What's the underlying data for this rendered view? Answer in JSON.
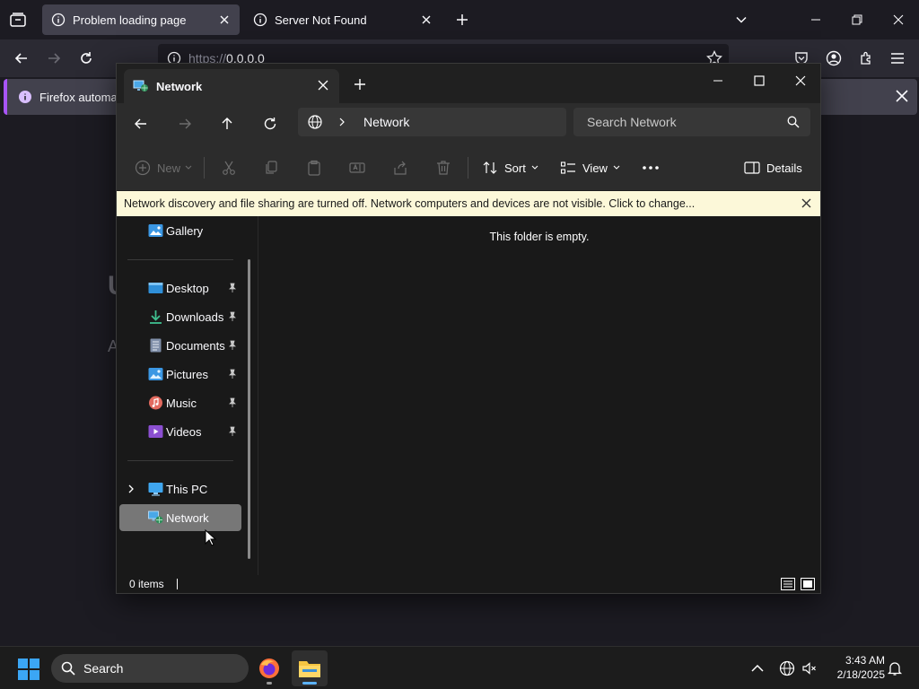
{
  "browser": {
    "tabs": [
      {
        "title": "Problem loading page",
        "active": true
      },
      {
        "title": "Server Not Found",
        "active": false
      }
    ],
    "url": {
      "scheme": "https://",
      "host": "0.0.0.0"
    },
    "notification": "Firefox automatic"
  },
  "explorer": {
    "tab_title": "Network",
    "breadcrumb": "Network",
    "search_placeholder": "Search Network",
    "commands": {
      "new": "New",
      "sort": "Sort",
      "view": "View",
      "details": "Details"
    },
    "infobar": "Network discovery and file sharing are turned off. Network computers and devices are not visible. Click to change...",
    "empty_message": "This folder is empty.",
    "nav": {
      "gallery": "Gallery",
      "quick_access": [
        {
          "label": "Desktop",
          "icon": "desktop-icon",
          "pinned": true
        },
        {
          "label": "Downloads",
          "icon": "downloads-icon",
          "pinned": true
        },
        {
          "label": "Documents",
          "icon": "documents-icon",
          "pinned": true
        },
        {
          "label": "Pictures",
          "icon": "pictures-icon",
          "pinned": true
        },
        {
          "label": "Music",
          "icon": "music-icon",
          "pinned": true
        },
        {
          "label": "Videos",
          "icon": "videos-icon",
          "pinned": true
        }
      ],
      "this_pc": "This PC",
      "network": "Network"
    },
    "status": {
      "item_count": "0 items"
    }
  },
  "taskbar": {
    "search_label": "Search",
    "time": "3:43 AM",
    "date": "2/18/2025"
  },
  "colors": {
    "explorer_bg": "#191919",
    "infobar_bg": "#fcf8d9",
    "selected_nav": "#777777",
    "firefox_accent": "#a855f7",
    "windows_blue": "#3ba6f5"
  }
}
